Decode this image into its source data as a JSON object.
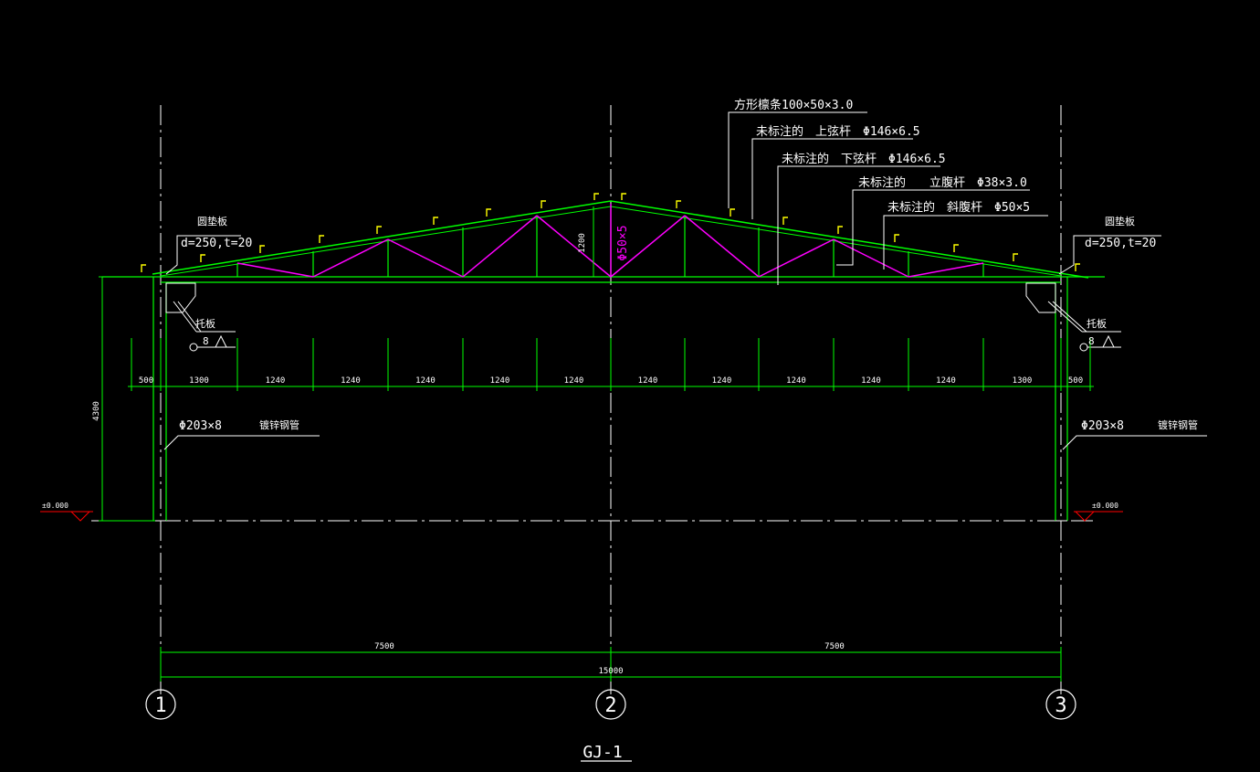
{
  "drawing_title": "GJ-1",
  "colors": {
    "background": "#000000",
    "structure": "#00ff00",
    "diagonal": "#ff00ff",
    "purlin": "#ffff00",
    "text": "#ffffff",
    "ground": "#ff0000"
  },
  "callouts": {
    "purlin": "方形檩条100×50×3.0",
    "top_chord": "未标注的　上弦杆　Φ146×6.5",
    "bottom_chord": "未标注的　下弦杆　Φ146×6.5",
    "vertical_web": "未标注的　　立腹杆　Φ38×3.0",
    "diagonal_web": "未标注的　斜腹杆　Φ50×5"
  },
  "left": {
    "plate_label": "圆垫板",
    "plate_spec": "d=250,t=20",
    "bracket_label": "托板",
    "bracket_thickness": "8",
    "column_spec": "Φ203×8",
    "column_material": "镀锌钢管",
    "elevation": "±0.000"
  },
  "right": {
    "plate_label": "圆垫板",
    "plate_spec": "d=250,t=20",
    "bracket_label": "托板",
    "bracket_thickness": "8",
    "column_spec": "Φ203×8",
    "column_material": "镀锌钢管",
    "elevation": "±0.000"
  },
  "truss_height": "1200",
  "center_member": "Φ50×5",
  "column_height": "4300",
  "panel_dims": [
    "500",
    "1300",
    "1240",
    "1240",
    "1240",
    "1240",
    "1240",
    "1240",
    "1240",
    "1240",
    "1240",
    "1240",
    "1300",
    "500"
  ],
  "span_dims": [
    "7500",
    "7500"
  ],
  "total_span": "15000",
  "axes": [
    "1",
    "2",
    "3"
  ]
}
